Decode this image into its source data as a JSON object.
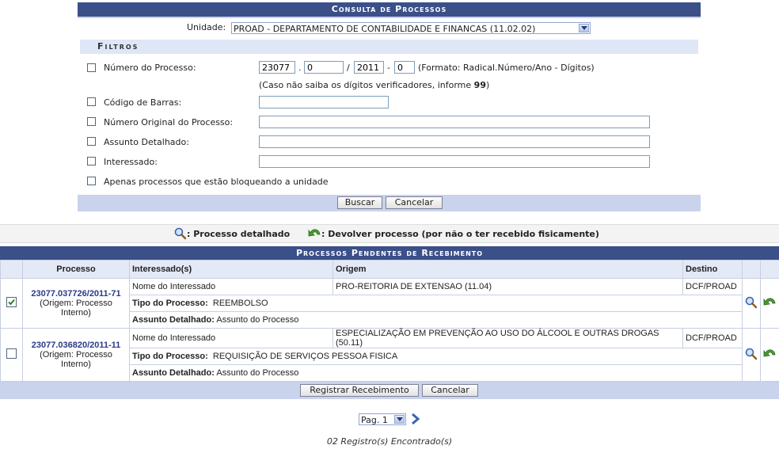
{
  "search": {
    "title": "Consulta de Processos",
    "unit_label": "Unidade:",
    "unit_value": "PROAD - DEPARTAMENTO DE CONTABILIDADE E FINANCAS (11.02.02)",
    "filters_title": "Filtros",
    "process_number_label": "Número do Processo:",
    "radical": "23077",
    "numero": "0",
    "ano": "2011",
    "digitos": "0",
    "dot": ".",
    "slash": "/",
    "dash": "-",
    "format_hint": "(Formato: Radical.Número/Ano - Dígitos)",
    "digits_hint_prefix": "(Caso não saiba os dígitos verificadores, informe ",
    "digits_hint_value": "99",
    "digits_hint_suffix": ")",
    "barcode_label": "Código de Barras:",
    "original_number_label": "Número Original do Processo:",
    "subject_label": "Assunto Detalhado:",
    "interested_label": "Interessado:",
    "blocking_label": "Apenas processos que estão bloqueando a unidade",
    "search_button": "Buscar",
    "cancel_button": "Cancelar"
  },
  "legend": {
    "detail": ": Processo detalhado",
    "return": ": Devolver processo (por não o ter recebido fisicamente)"
  },
  "results": {
    "title": "Processos Pendentes de Recebimento",
    "headers": [
      "Processo",
      "Interessado(s)",
      "Origem",
      "Destino"
    ],
    "type_label": "Tipo do Processo:",
    "subject_label": "Assunto Detalhado:",
    "rows": [
      {
        "checked": true,
        "process": "23077.037726/2011-71",
        "origin_note": "(Origem: Processo Interno)",
        "interested": "Nome do Interessado",
        "origin": "PRO-REITORIA DE EXTENSAO (11.04)",
        "destination": "DCF/PROAD",
        "type": "REEMBOLSO",
        "subject": "Assunto do Processo"
      },
      {
        "checked": false,
        "process": "23077.036820/2011-11",
        "origin_note": "(Origem: Processo Interno)",
        "interested": "Nome do Interessado",
        "origin": "ESPECIALIZAÇÃO EM PREVENÇÃO AO USO DO ÁLCOOL E OUTRAS DROGAS (50.11)",
        "destination": "DCF/PROAD",
        "type": "REQUISIÇÃO DE SERVIÇOS PESSOA FISICA",
        "subject": "Assunto do Processo"
      }
    ],
    "register_button": "Registrar Recebimento",
    "cancel_button": "Cancelar"
  },
  "pagination": {
    "page_value": "Pag. 1"
  },
  "footer": {
    "records_found": "02 Registro(s) Encontrado(s)"
  },
  "icons": {
    "detail": "magnifier-icon",
    "return": "undo-arrow-icon",
    "next": "chevron-right-icon"
  },
  "colors": {
    "header_bar": "#3b4f89",
    "button_bar": "#c9d3ec",
    "link": "#2a3a8a",
    "return_icon": "#3a8a2a"
  }
}
